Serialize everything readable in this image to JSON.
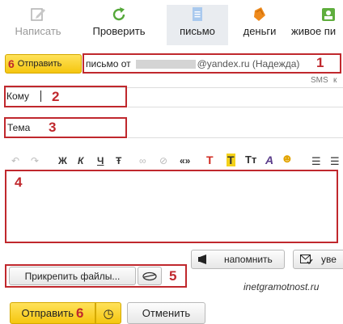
{
  "toolbar": {
    "compose": "Написать",
    "check": "Проверить",
    "letter": "письмо",
    "money": "деньги",
    "live": "живое пи"
  },
  "send_top": {
    "number": "6",
    "label": "Отправить"
  },
  "from": {
    "prefix": "письмо от",
    "domain": "@yandex.ru (Надежда)",
    "number": "1",
    "sms": "SMS",
    "cut": "к"
  },
  "to": {
    "label": "Кому",
    "number": "2"
  },
  "subject": {
    "label": "Тема",
    "number": "3"
  },
  "format_bar": {
    "undo": "↶",
    "redo": "↷",
    "bold": "Ж",
    "italic": "К",
    "underline": "Ч",
    "strike": "Ŧ",
    "link": "∞",
    "unlink": "⊘",
    "quote": "«»",
    "color_t": "T",
    "bg_t": "T",
    "size_t": "Tт",
    "font_a": "A",
    "emoji": "☻",
    "list1": "☰",
    "list2": "☰"
  },
  "body": {
    "number": "4"
  },
  "remind": {
    "label": "напомнить"
  },
  "notify": {
    "label": "уве"
  },
  "attach": {
    "label": "Прикрепить файлы...",
    "number": "5"
  },
  "watermark": "inetgramotnost.ru",
  "bottom": {
    "send_label": "Отправить",
    "send_number": "6",
    "clock": "◷",
    "cancel": "Отменить"
  },
  "colors": {
    "accent_red": "#c0282d",
    "send_yellow": "#f5c60f"
  }
}
